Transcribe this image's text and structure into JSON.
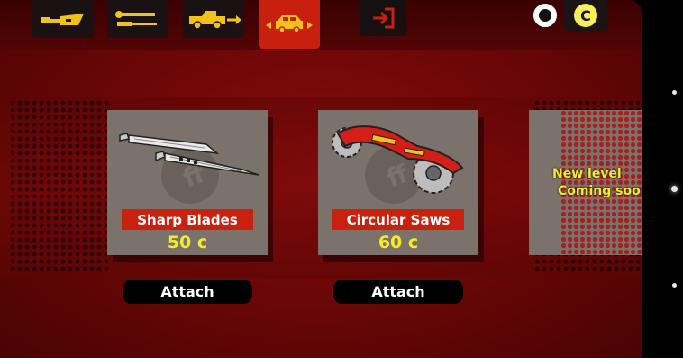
{
  "tabs": [
    {
      "name": "blade-parts-tab",
      "icon": "blade-icon"
    },
    {
      "name": "tools-tab",
      "icon": "wrench-screwdriver-icon"
    },
    {
      "name": "tow-truck-tab",
      "icon": "tow-truck-icon"
    },
    {
      "name": "car-attachments-tab",
      "icon": "car-arrows-icon",
      "active": true
    }
  ],
  "exit": {
    "icon": "exit-door-icon"
  },
  "currency": {
    "ring_icon": "ring-icon",
    "coin_icon": "coin-icon",
    "coin_symbol": "C"
  },
  "items": [
    {
      "label": "Sharp Blades",
      "price": "50 c",
      "attach_label": "Attach",
      "icon": "blades-icon"
    },
    {
      "label": "Circular Saws",
      "price": "60 c",
      "attach_label": "Attach",
      "icon": "circular-saw-icon"
    }
  ],
  "locked_item": {
    "line1": "New level",
    "line2": "Coming soon"
  },
  "colors": {
    "accent_red": "#c8220f",
    "price_yellow": "#f4ec2a",
    "background_red": "#7a0909",
    "card_gray": "#7b726b"
  }
}
